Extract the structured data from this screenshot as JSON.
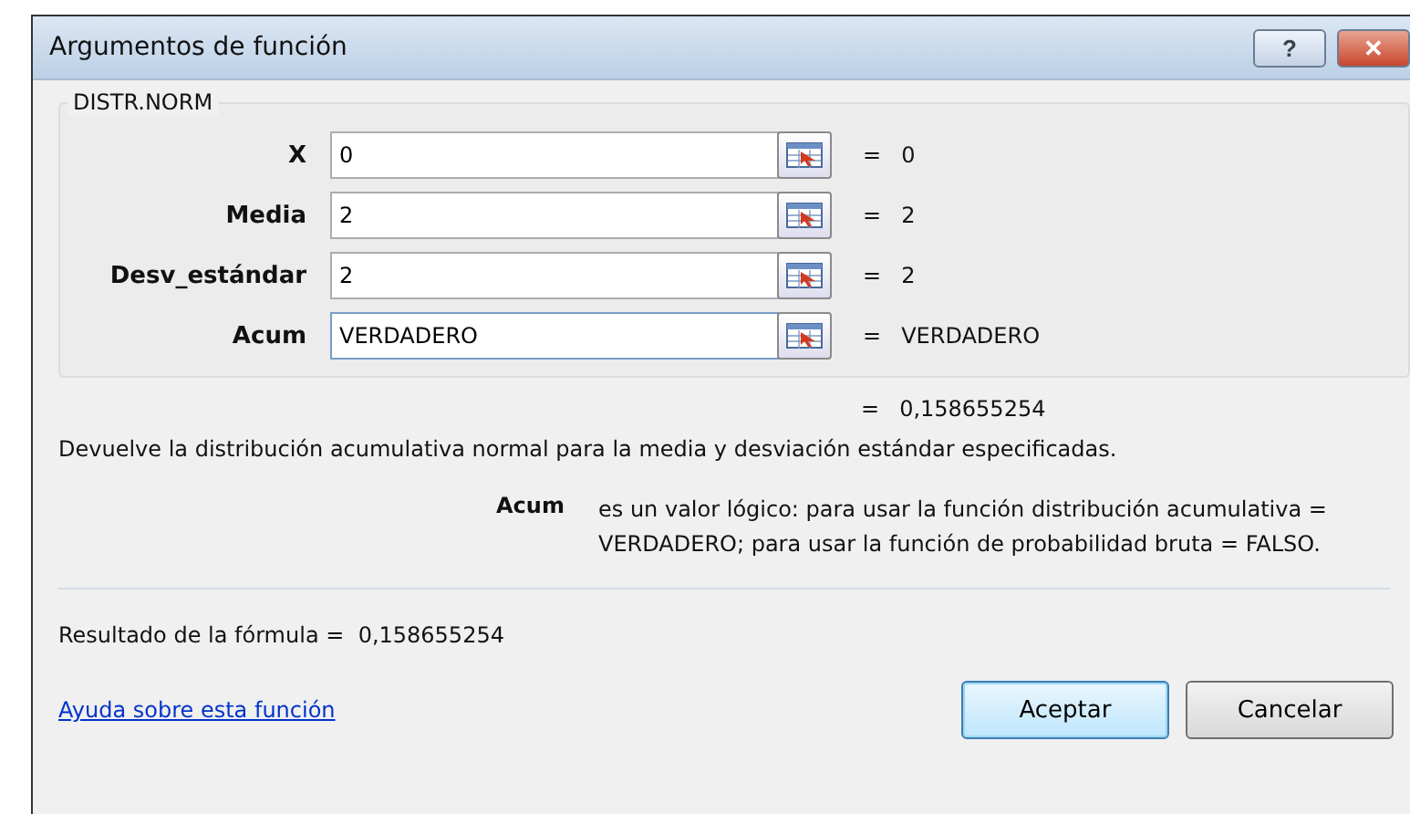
{
  "window": {
    "title": "Argumentos de función",
    "help_button": "?",
    "close_button": "✕"
  },
  "group": {
    "title": "DISTR.NORM",
    "arguments": [
      {
        "label": "X",
        "value": "0",
        "equals": "=",
        "result": "0",
        "focused": false
      },
      {
        "label": "Media",
        "value": "2",
        "equals": "=",
        "result": "2",
        "focused": false
      },
      {
        "label": "Desv_estándar",
        "value": "2",
        "equals": "=",
        "result": "2",
        "focused": false
      },
      {
        "label": "Acum",
        "value": "VERDADERO",
        "equals": "=",
        "result": "VERDADERO",
        "focused": true
      }
    ]
  },
  "function_result": {
    "equals": "=",
    "value": "0,158655254"
  },
  "description": "Devuelve la distribución acumulativa normal para la media y desviación estándar especificadas.",
  "argument_help": {
    "name": "Acum",
    "text": "es un valor lógico: para usar la función distribución acumulativa = VERDADERO; para usar la función de probabilidad bruta = FALSO."
  },
  "formula_result": {
    "label": "Resultado de la fórmula =",
    "value": "0,158655254"
  },
  "help_link": "Ayuda sobre esta función",
  "buttons": [
    {
      "label": "Aceptar",
      "default": true
    },
    {
      "label": "Cancelar",
      "default": false
    }
  ]
}
